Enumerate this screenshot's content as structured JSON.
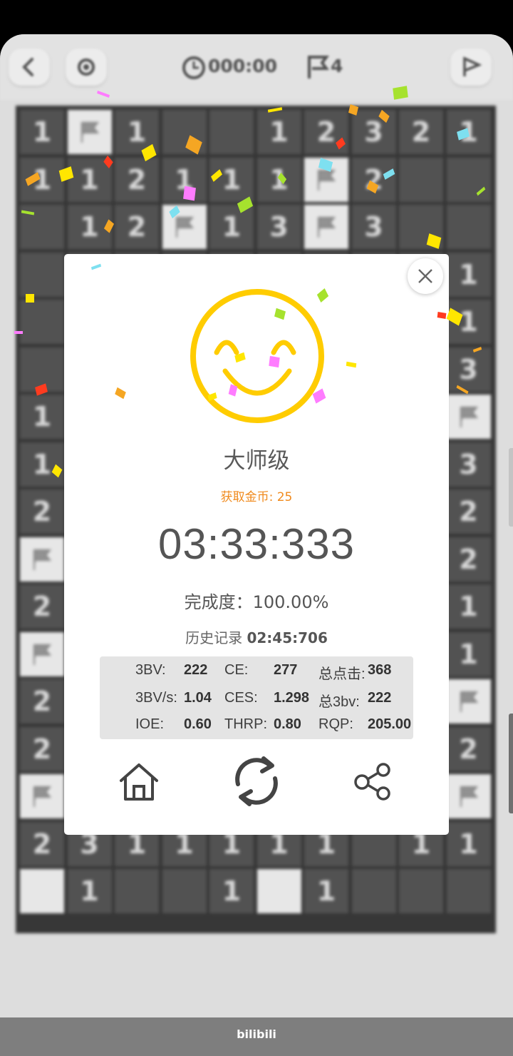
{
  "toolbar": {
    "timer": "&#8203;",
    "timer_text": "000:00",
    "flags_text": "4",
    "icons": [
      "back-icon",
      "settings-icon",
      "clock-icon",
      "flag-icon",
      "send-flag-icon"
    ]
  },
  "board": {
    "rows": [
      [
        "1",
        "F",
        "1",
        "",
        "",
        "1",
        "2",
        "3",
        "2",
        "1"
      ],
      [
        "1",
        "1",
        "2",
        "1",
        "1",
        "1",
        "F",
        "2",
        "",
        ""
      ],
      [
        "",
        "1",
        "2",
        "F",
        "1",
        "3",
        "F",
        "3",
        "",
        ""
      ],
      [
        "",
        "",
        "",
        "",
        "",
        "",
        "",
        "",
        "",
        "1"
      ],
      [
        "",
        "",
        "",
        "",
        "",
        "",
        "",
        "",
        "",
        "1"
      ],
      [
        "",
        "",
        "",
        "",
        "",
        "",
        "",
        "",
        "",
        "3"
      ],
      [
        "1",
        "",
        "",
        "",
        "",
        "",
        "",
        "",
        "",
        "F"
      ],
      [
        "1",
        "",
        "",
        "",
        "",
        "",
        "",
        "",
        "",
        "3"
      ],
      [
        "2",
        "",
        "",
        "",
        "",
        "",
        "",
        "",
        "",
        "2"
      ],
      [
        "F",
        "",
        "",
        "",
        "",
        "",
        "",
        "",
        "",
        "2"
      ],
      [
        "2",
        "",
        "",
        "",
        "",
        "",
        "",
        "",
        "",
        "1"
      ],
      [
        "F",
        "",
        "",
        "",
        "",
        "",
        "",
        "",
        "",
        "1"
      ],
      [
        "2",
        "",
        "",
        "",
        "",
        "",
        "",
        "",
        "",
        "F"
      ],
      [
        "2",
        "",
        "",
        "",
        "",
        "",
        "",
        "",
        "",
        "2"
      ],
      [
        "F",
        "",
        "",
        "",
        "",
        "",
        "",
        "",
        "",
        "F"
      ],
      [
        "2",
        "3",
        "1",
        "1",
        "1",
        "1",
        "1",
        "",
        "1",
        "1"
      ],
      [
        "O",
        "1",
        "",
        "",
        "1",
        "O",
        "1",
        "",
        "",
        ""
      ]
    ]
  },
  "result": {
    "level": "大师级",
    "coins_label": "获取金币: 25",
    "time": "03:33:333",
    "completion": "完成度：100.00%",
    "history_label": "历史记录",
    "history_value": "02:45:706"
  },
  "stats": [
    {
      "label": "3BV:",
      "value": "222"
    },
    {
      "label": "CE:",
      "value": "277"
    },
    {
      "label": "总点击:",
      "value": "368"
    },
    {
      "label": "3BV/s:",
      "value": "1.04"
    },
    {
      "label": "CES:",
      "value": "1.298"
    },
    {
      "label": "总3bv:",
      "value": "222"
    },
    {
      "label": "IOE:",
      "value": "0.60"
    },
    {
      "label": "THRP:",
      "value": "0.80"
    },
    {
      "label": "RQP:",
      "value": "205.00"
    }
  ],
  "actions": [
    "home-icon",
    "restart-icon",
    "share-icon"
  ],
  "brand": "bilibili",
  "colors": {
    "smiley": "#ffcc00",
    "coins": "#f08a1d",
    "stats_bg": "#e4e4e4"
  }
}
